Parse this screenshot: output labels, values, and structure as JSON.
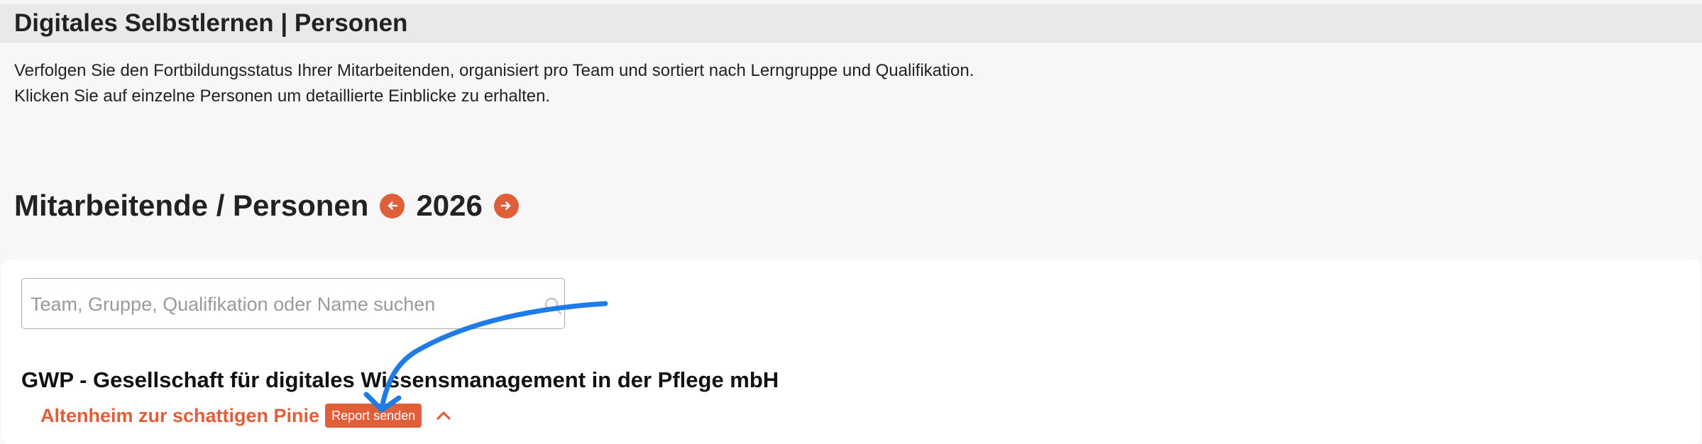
{
  "header": {
    "title": "Digitales Selbstlernen | Personen"
  },
  "intro": {
    "line1": "Verfolgen Sie den Fortbildungsstatus Ihrer Mitarbeitenden, organisiert pro Team und sortiert nach Lerngruppe und Qualifikation.",
    "line2": "Klicken Sie auf einzelne Personen um detaillierte Einblicke zu erhalten."
  },
  "section": {
    "title": "Mitarbeitende / Personen",
    "year": "2026",
    "prev_icon": "arrow-left-icon",
    "next_icon": "arrow-right-icon"
  },
  "search": {
    "placeholder": "Team, Gruppe, Qualifikation oder Name suchen",
    "value": "",
    "icon": "search-icon"
  },
  "organization": {
    "name": "GWP - Gesellschaft für digitales Wissensmanagement in der Pflege mbH",
    "teams": [
      {
        "name": "Altenheim zur schattigen Pinie",
        "report_label": "Report senden",
        "expanded": true
      }
    ]
  },
  "colors": {
    "accent": "#e05f3b",
    "annotation_arrow": "#1f7be8",
    "title_bar": "#e9e9e9",
    "page_bg": "#f7f7f7"
  }
}
